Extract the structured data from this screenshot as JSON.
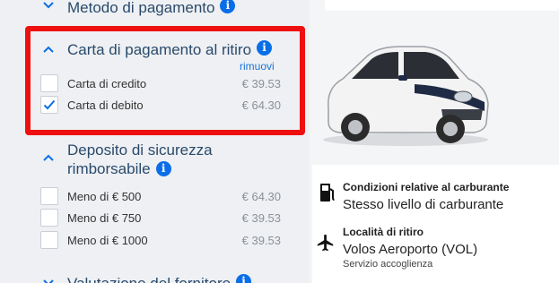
{
  "payment_method": {
    "title": "Metodo di pagamento"
  },
  "pickup_card": {
    "title": "Carta di pagamento al ritiro",
    "remove_label": "rimuovi",
    "options": [
      {
        "label": "Carta di credito",
        "price": "€ 39.53",
        "checked": false
      },
      {
        "label": "Carta di debito",
        "price": "€ 64.30",
        "checked": true
      }
    ]
  },
  "deposit": {
    "title_line1": "Deposito di sicurezza",
    "title_line2": "rimborsabile",
    "options": [
      {
        "label": "Meno di € 500",
        "price": "€ 64.30",
        "checked": false
      },
      {
        "label": "Meno di € 750",
        "price": "€ 39.53",
        "checked": false
      },
      {
        "label": "Meno di € 1000",
        "price": "€ 39.53",
        "checked": false
      }
    ]
  },
  "supplier_rating": {
    "title": "Valutazione del fornitore"
  },
  "car_info": {
    "fuel": {
      "title": "Condizioni relative al carburante",
      "value": "Stesso livello di carburante"
    },
    "pickup": {
      "title": "Località di ritiro",
      "value": "Volos Aeroporto (VOL)",
      "sub": "Servizio accoglienza"
    }
  },
  "colors": {
    "accent": "#0a6ee8",
    "highlight": "#ee1010",
    "heading": "#2a4a6b"
  }
}
